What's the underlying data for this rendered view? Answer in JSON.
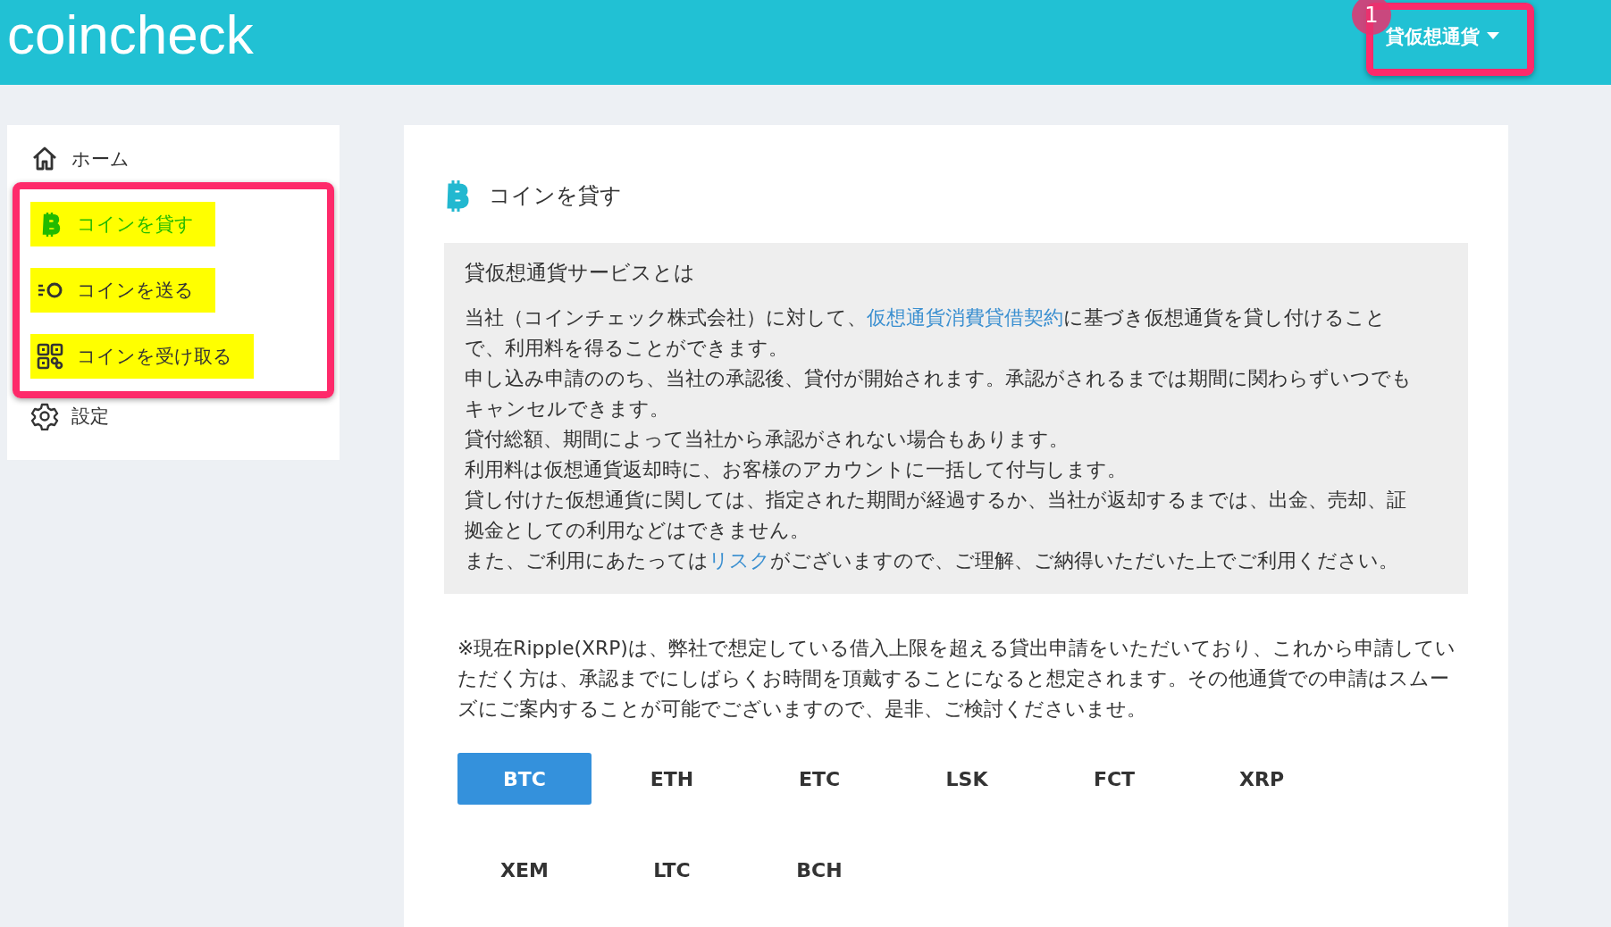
{
  "header": {
    "logo": "coincheck",
    "menu": {
      "label": "貸仮想通貨",
      "badge": "1"
    }
  },
  "sidebar": {
    "items": [
      {
        "label": "ホーム",
        "kind": "home",
        "selected": false,
        "highlighted": false
      },
      {
        "label": "コインを貸す",
        "kind": "lend",
        "selected": true,
        "highlighted": true
      },
      {
        "label": "コインを送る",
        "kind": "send",
        "selected": false,
        "highlighted": true
      },
      {
        "label": "コインを受け取る",
        "kind": "receive",
        "selected": false,
        "highlighted": true
      },
      {
        "label": "設定",
        "kind": "settings",
        "selected": false,
        "highlighted": false
      }
    ]
  },
  "main": {
    "title": "コインを貸す",
    "info": {
      "heading": "貸仮想通貨サービスとは",
      "paragraphs": [
        [
          {
            "text": "当社（コインチェック株式会社）に対して、",
            "link": false
          },
          {
            "text": "仮想通貨消費貸借契約",
            "link": true
          },
          {
            "text": "に基づき仮想通貨を貸し付けることで、利用料を得ることができます。",
            "link": false
          }
        ],
        [
          {
            "text": "申し込み申請ののち、当社の承認後、貸付が開始されます。承認がされるまでは期間に関わらずいつでもキャンセルできます。",
            "link": false
          }
        ],
        [
          {
            "text": "貸付総額、期間によって当社から承認がされない場合もあります。",
            "link": false
          }
        ],
        [
          {
            "text": "利用料は仮想通貨返却時に、お客様のアカウントに一括して付与します。",
            "link": false
          }
        ],
        [
          {
            "text": "貸し付けた仮想通貨に関しては、指定された期間が経過するか、当社が返却するまでは、出金、売却、証拠金としての利用などはできません。",
            "link": false
          }
        ],
        [
          {
            "text": "また、ご利用にあたっては",
            "link": false
          },
          {
            "text": "リスク",
            "link": true
          },
          {
            "text": "がございますので、ご理解、ご納得いただいた上でご利用ください。",
            "link": false
          }
        ]
      ]
    },
    "notice": "※現在Ripple(XRP)は、弊社で想定している借入上限を超える貸出申請をいただいており、これから申請していただく方は、承認までにしばらくお時間を頂戴することになると想定されます。その他通貨での申請はスムーズにご案内することが可能でございますので、是非、ご検討くださいませ。",
    "coins": [
      {
        "label": "BTC",
        "selected": true
      },
      {
        "label": "ETH",
        "selected": false
      },
      {
        "label": "ETC",
        "selected": false
      },
      {
        "label": "LSK",
        "selected": false
      },
      {
        "label": "FCT",
        "selected": false
      },
      {
        "label": "XRP",
        "selected": false
      },
      {
        "label": "XEM",
        "selected": false
      },
      {
        "label": "LTC",
        "selected": false
      },
      {
        "label": "BCH",
        "selected": false
      }
    ]
  }
}
